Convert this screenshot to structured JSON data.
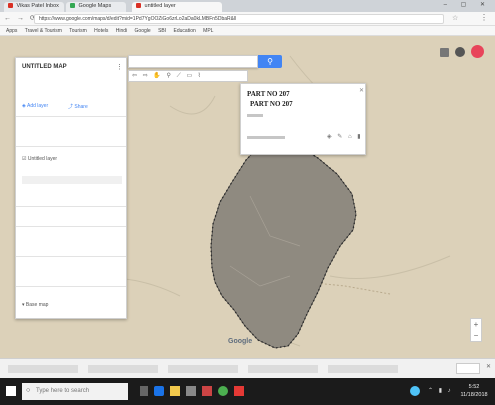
{
  "browser": {
    "tabs": [
      {
        "label": "Vikas Patel Inbox"
      },
      {
        "label": "Google Maps"
      },
      {
        "label": "untitled layer"
      }
    ],
    "url": "https://www.google.com/maps/d/edit?mid=1Pd7YgOOZiGo6zrLo2aDa0kLMBFn5DbaR&ll",
    "bookmarks": [
      "Apps",
      "Travel & Tourism",
      "Tourism",
      "Hotels",
      "Hindi",
      "Google",
      "SBI",
      "Education",
      "MPL"
    ]
  },
  "map": {
    "search_placeholder": "",
    "toolbar": "⇦ ⇨ ✋ ⚲ ⟋ ▭ ⌇",
    "google_logo": "Google",
    "labels": [
      "PART NO 207"
    ],
    "zoom_in": "+",
    "zoom_out": "−",
    "colors": {
      "terrain": "#dcd1b9",
      "polygon": "#8f8a80",
      "polygon_stroke": "#2b2b2b",
      "accent_blue": "#4285f4"
    }
  },
  "panel": {
    "title": "UNTITLED MAP",
    "items": [
      "Untitled layer",
      "Add layer",
      "Share",
      "Base map"
    ]
  },
  "popup": {
    "title": "PART NO 207"
  },
  "taskbar": {
    "search_placeholder": "Type here to search",
    "time": "5:52",
    "date": "11/18/2018"
  }
}
